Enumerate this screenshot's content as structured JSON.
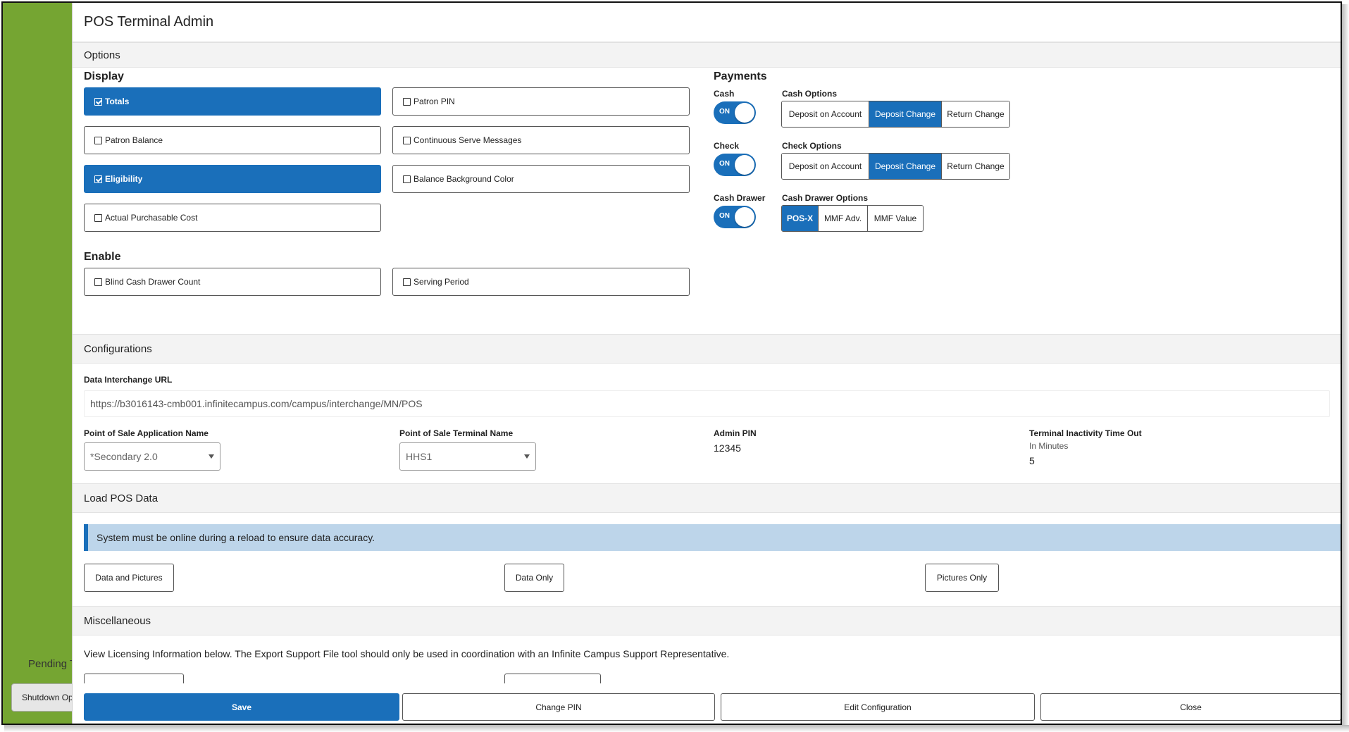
{
  "background": {
    "pending_text": "Pending T",
    "shutdown_label": "Shutdown Op"
  },
  "modal": {
    "title": "POS Terminal Admin"
  },
  "options": {
    "section_title": "Options",
    "display": {
      "heading": "Display",
      "items": [
        {
          "label": "Totals",
          "checked": true
        },
        {
          "label": "Patron PIN",
          "checked": false
        },
        {
          "label": "Patron Balance",
          "checked": false
        },
        {
          "label": "Continuous Serve Messages",
          "checked": false
        },
        {
          "label": "Eligibility",
          "checked": true
        },
        {
          "label": "Balance Background Color",
          "checked": false
        },
        {
          "label": "Actual Purchasable Cost",
          "checked": false
        }
      ]
    },
    "enable": {
      "heading": "Enable",
      "items": [
        {
          "label": "Blind Cash Drawer Count",
          "checked": false
        },
        {
          "label": "Serving Period",
          "checked": false
        }
      ]
    },
    "payments": {
      "heading": "Payments",
      "cash": {
        "label": "Cash",
        "toggle": "ON",
        "options_label": "Cash Options",
        "options": [
          "Deposit on Account",
          "Deposit Change",
          "Return Change"
        ],
        "selected": "Deposit Change"
      },
      "check": {
        "label": "Check",
        "toggle": "ON",
        "options_label": "Check Options",
        "options": [
          "Deposit on Account",
          "Deposit Change",
          "Return Change"
        ],
        "selected": "Deposit Change"
      },
      "cash_drawer": {
        "label": "Cash Drawer",
        "toggle": "ON",
        "options_label": "Cash Drawer Options",
        "options": [
          "POS-X",
          "MMF Adv.",
          "MMF Value"
        ],
        "selected": "POS-X"
      }
    }
  },
  "configurations": {
    "section_title": "Configurations",
    "url_label": "Data Interchange URL",
    "url_value": "https://b3016143-cmb001.infinitecampus.com/campus/interchange/MN/POS",
    "app_name_label": "Point of Sale Application Name",
    "app_name_value": "*Secondary 2.0",
    "terminal_name_label": "Point of Sale Terminal Name",
    "terminal_name_value": "HHS1",
    "admin_pin_label": "Admin PIN",
    "admin_pin_value": "12345",
    "timeout_label": "Terminal Inactivity Time Out",
    "timeout_sublabel": "In Minutes",
    "timeout_value": "5"
  },
  "load_pos": {
    "section_title": "Load POS Data",
    "alert": "System must be online during a reload to ensure data accuracy.",
    "buttons": [
      "Data and Pictures",
      "Data Only",
      "Pictures Only"
    ]
  },
  "misc": {
    "section_title": "Miscellaneous",
    "text": "View Licensing Information below. The Export Support File tool should only be used in coordination with an Infinite Campus Support Representative."
  },
  "footer": {
    "save": "Save",
    "change_pin": "Change PIN",
    "edit_config": "Edit Configuration",
    "close": "Close"
  },
  "colors": {
    "accent": "#1a6fba",
    "app_green": "#75a532",
    "alert_bg": "#bdd5ea"
  }
}
